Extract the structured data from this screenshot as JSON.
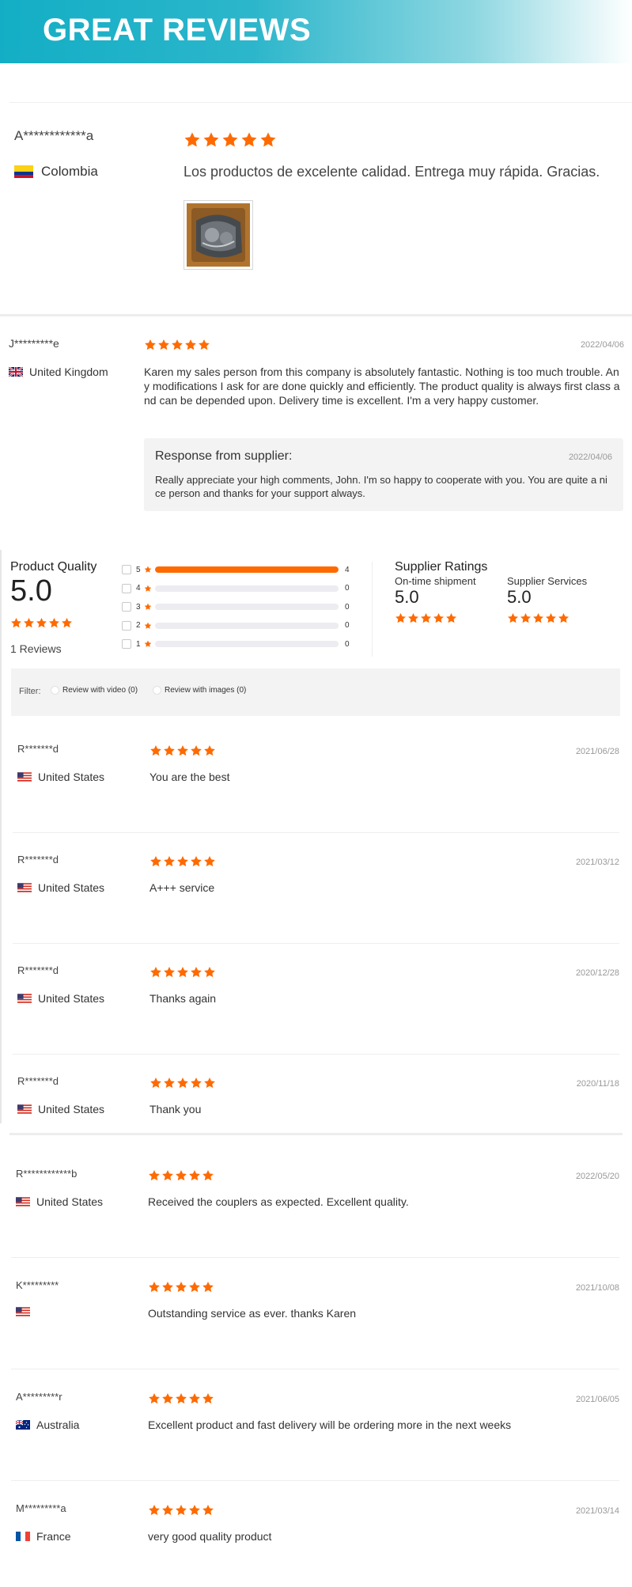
{
  "banner": {
    "title": "GREAT REVIEWS"
  },
  "featured": [
    {
      "name": "A************a",
      "country": "Colombia",
      "flag": "colombia",
      "rating": 5,
      "text": "Los productos de excelente calidad. Entrega muy rápida. Gracias."
    },
    {
      "name": "J*********e",
      "country": "United Kingdom",
      "flag": "uk",
      "rating": 5,
      "date": "2022/04/06",
      "text": "Karen my sales person from this company is absolutely fantastic. Nothing is too much trouble. Any modifications I ask for are done quickly and efficiently. The product quality is always first class and can be depended upon. Delivery time is excellent. I'm a very happy customer.",
      "response": {
        "title": "Response from supplier:",
        "date": "2022/04/06",
        "text": "Really appreciate your high comments, John. I'm so happy to cooperate with you. You are quite a nice person and thanks for your support always."
      }
    }
  ],
  "summary": {
    "product_quality": {
      "title": "Product Quality",
      "score": "5.0",
      "rating": 5,
      "reviews": "1 Reviews"
    },
    "distribution": [
      {
        "star": "5",
        "count": "4",
        "fill": 1.0
      },
      {
        "star": "4",
        "count": "0",
        "fill": 0
      },
      {
        "star": "3",
        "count": "0",
        "fill": 0
      },
      {
        "star": "2",
        "count": "0",
        "fill": 0
      },
      {
        "star": "1",
        "count": "0",
        "fill": 0
      }
    ],
    "supplier": {
      "title": "Supplier Ratings",
      "items": [
        {
          "label": "On-time shipment",
          "score": "5.0",
          "rating": 5
        },
        {
          "label": "Supplier Services",
          "score": "5.0",
          "rating": 5
        }
      ]
    },
    "filter": {
      "label": "Filter:",
      "options": [
        "Review with video (0)",
        "Review with images (0)"
      ]
    }
  },
  "reviews_a": [
    {
      "name": "R*******d",
      "country": "United States",
      "flag": "us",
      "rating": 5,
      "date": "2021/06/28",
      "text": "You are the best"
    },
    {
      "name": "R*******d",
      "country": "United States",
      "flag": "us",
      "rating": 5,
      "date": "2021/03/12",
      "text": "A+++ service"
    },
    {
      "name": "R*******d",
      "country": "United States",
      "flag": "us",
      "rating": 5,
      "date": "2020/12/28",
      "text": "Thanks again"
    },
    {
      "name": "R*******d",
      "country": "United States",
      "flag": "us",
      "rating": 5,
      "date": "2020/11/18",
      "text": "Thank you"
    }
  ],
  "reviews_b": [
    {
      "name": "R************b",
      "country": "United States",
      "flag": "us",
      "rating": 5,
      "date": "2022/05/20",
      "text": "Received the couplers as expected. Excellent quality."
    },
    {
      "name": "K*********",
      "country": "",
      "flag": "us",
      "rating": 5,
      "date": "2021/10/08",
      "text": "Outstanding service as ever. thanks Karen"
    },
    {
      "name": "A*********r",
      "country": "Australia",
      "flag": "australia",
      "rating": 5,
      "date": "2021/06/05",
      "text": "Excellent product and fast delivery will be ordering more in the next weeks"
    },
    {
      "name": "M*********a",
      "country": "France",
      "flag": "france",
      "rating": 5,
      "date": "2021/03/14",
      "text": "very good quality product"
    }
  ],
  "colors": {
    "star": "#ff6a00",
    "banner_start": "#13aec5",
    "bar_fill": "#ff6a00"
  }
}
